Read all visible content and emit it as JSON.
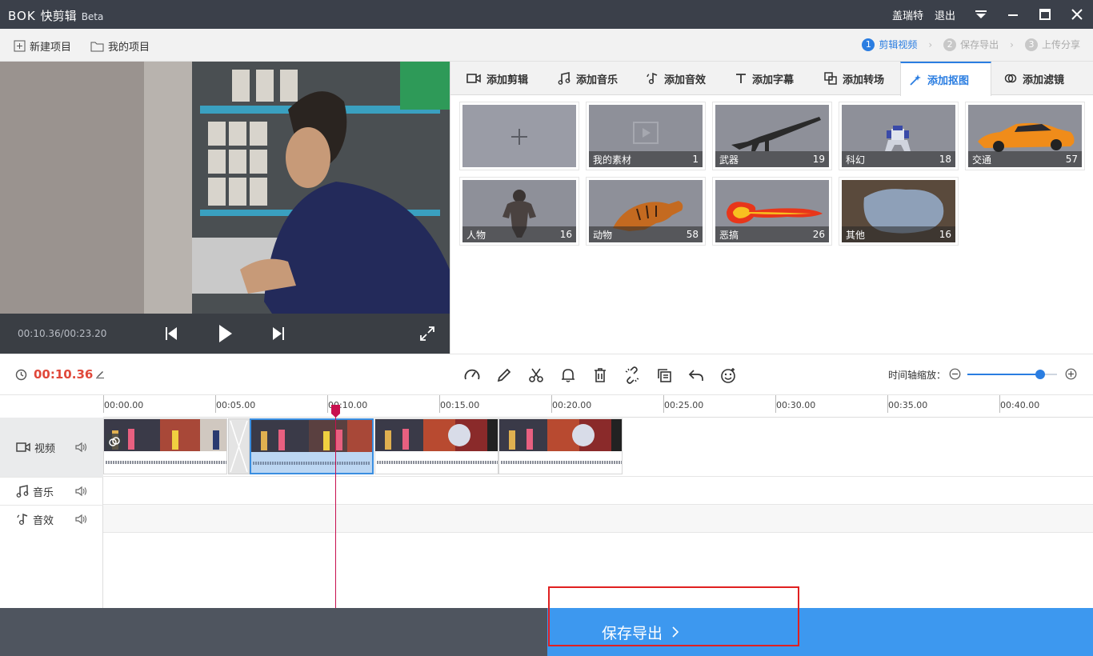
{
  "titlebar": {
    "brand": "BOK",
    "app_name": "快剪辑",
    "beta": "Beta",
    "user": "盖瑞特",
    "logout": "退出",
    "icons": [
      "menu-dropdown-icon",
      "minimize-icon",
      "maximize-icon",
      "close-icon"
    ]
  },
  "toolbar": {
    "new_project": "新建项目",
    "my_projects": "我的项目",
    "steps": [
      {
        "num": "1",
        "label": "剪辑视频"
      },
      {
        "num": "2",
        "label": "保存导出"
      },
      {
        "num": "3",
        "label": "上传分享"
      }
    ]
  },
  "player": {
    "time": "00:10.36/00:23.20"
  },
  "tabs": [
    "添加剪辑",
    "添加音乐",
    "添加音效",
    "添加字幕",
    "添加转场",
    "添加抠图",
    "添加滤镜"
  ],
  "active_tab": "添加抠图",
  "materials": [
    {
      "label": "",
      "count": "",
      "icon": "plus-icon"
    },
    {
      "label": "我的素材",
      "count": "1",
      "icon": "video-placeholder-icon"
    },
    {
      "label": "武器",
      "count": "19",
      "icon": "rifle-image"
    },
    {
      "label": "科幻",
      "count": "18",
      "icon": "robot-image"
    },
    {
      "label": "交通",
      "count": "57",
      "icon": "car-image"
    },
    {
      "label": "人物",
      "count": "16",
      "icon": "gorilla-image"
    },
    {
      "label": "动物",
      "count": "58",
      "icon": "tiger-image"
    },
    {
      "label": "恶搞",
      "count": "26",
      "icon": "fire-image"
    },
    {
      "label": "其他",
      "count": "16",
      "icon": "broken-wall-image"
    }
  ],
  "editbar": {
    "current_time": "00:10.36",
    "zoom_label": "时间轴缩放：",
    "zoom_level": 0.85
  },
  "timeline": {
    "ticks": [
      "00:00.00",
      "00:05.00",
      "00:10.00",
      "00:15.00",
      "00:20.00",
      "00:25.00",
      "00:30.00",
      "00:35.00",
      "00:40.00"
    ],
    "tracks": [
      "视频",
      "音乐",
      "音效"
    ]
  },
  "bottom": {
    "save_export": "保存导出"
  },
  "colors": {
    "accent": "#2a7de1",
    "playhead": "#c8104f",
    "time_red": "#e0483a",
    "save_button": "#3d98ef",
    "highlight_box": "#e02020"
  }
}
